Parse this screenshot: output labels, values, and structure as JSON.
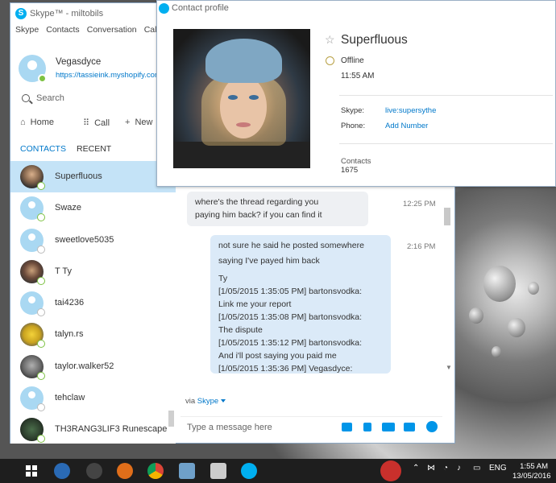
{
  "skype_window": {
    "title": "Skype™ - miltobils",
    "menu": [
      "Skype",
      "Contacts",
      "Conversation",
      "Call"
    ],
    "me": {
      "name": "Vegasdyce",
      "mood_url": "https://tassieink.myshopify.com"
    },
    "search_label": "Search",
    "nav": {
      "home": "Home",
      "call": "Call",
      "new": "New"
    },
    "tabs": {
      "contacts": "CONTACTS",
      "recent": "RECENT"
    },
    "contacts": [
      {
        "name": "Superfluous",
        "status": "online",
        "avatar": "photo1",
        "selected": true
      },
      {
        "name": "Swaze",
        "status": "online",
        "avatar": "placeholder"
      },
      {
        "name": "sweetlove5035",
        "status": "unknown",
        "avatar": "placeholder"
      },
      {
        "name": "T Ty",
        "status": "online",
        "avatar": "photo2"
      },
      {
        "name": "tai4236",
        "status": "unknown",
        "avatar": "placeholder"
      },
      {
        "name": "talyn.rs",
        "status": "online",
        "avatar": "photo3"
      },
      {
        "name": "taylor.walker52",
        "status": "online",
        "avatar": "photo4"
      },
      {
        "name": "tehclaw",
        "status": "unknown",
        "avatar": "placeholder"
      },
      {
        "name": "TH3RANG3LIF3 Runescape",
        "status": "online",
        "avatar": "photo5"
      }
    ]
  },
  "conversation": {
    "messages": [
      {
        "dir": "in",
        "lines": [
          "where's the thread regarding you",
          "paying him back? if you can find it"
        ],
        "time": "12:25 PM"
      },
      {
        "dir": "out",
        "lines": [
          "not sure he said he posted somewhere",
          "saying I've payed him back"
        ],
        "time": "2:16 PM"
      }
    ],
    "pasted": [
      "Ty",
      "[1/05/2015 1:35:05 PM] bartonsvodka:",
      "Link me your report",
      "[1/05/2015 1:35:08 PM] bartonsvodka:",
      "The dispute",
      "[1/05/2015 1:35:12 PM] bartonsvodka:",
      "And i'll post saying you paid me",
      "[1/05/2015 1:35:36 PM] Vegasdyce:"
    ],
    "via": "via",
    "via_service": "Skype",
    "composer_placeholder": "Type a message here"
  },
  "profile": {
    "window_title": "Contact profile",
    "name": "Superfluous",
    "status": "Offline",
    "local_time": "11:55 AM",
    "skype_label": "Skype:",
    "skype_value": "live:supersythe",
    "phone_label": "Phone:",
    "phone_value": "Add Number",
    "contacts_label": "Contacts",
    "contacts_count": "1675"
  },
  "taskbar": {
    "language": "ENG",
    "time": "1:55 AM",
    "date": "13/05/2016"
  },
  "colors": {
    "accent": "#0078ca",
    "skype_blue": "#00aff0",
    "online": "#7dc242",
    "selected_row": "#c4e3f7"
  }
}
